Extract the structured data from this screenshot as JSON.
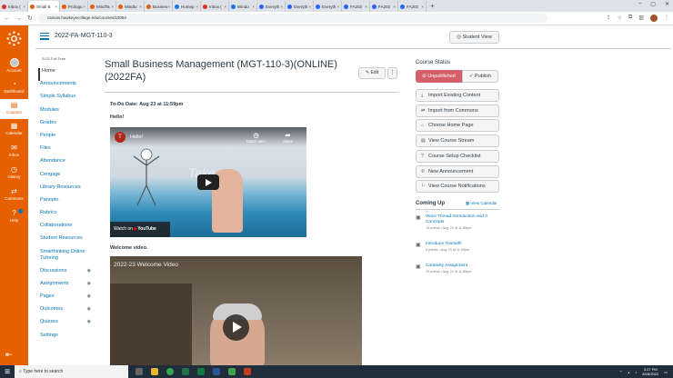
{
  "browser": {
    "tabs": [
      {
        "label": "Inbox (",
        "color": "#d93025"
      },
      {
        "label": "Small B",
        "color": "#e66000",
        "active": true
      },
      {
        "label": "Prologu",
        "color": "#e66000"
      },
      {
        "label": "MindTa",
        "color": "#e66000"
      },
      {
        "label": "Mindtu",
        "color": "#e66000"
      },
      {
        "label": "Busines",
        "color": "#e66000"
      },
      {
        "label": "Homep",
        "color": "#1a73e8"
      },
      {
        "label": "Inbox (",
        "color": "#d93025"
      },
      {
        "label": "Windo",
        "color": "#1a73e8"
      },
      {
        "label": "Everyth",
        "color": "#2962ff"
      },
      {
        "label": "Everyth",
        "color": "#2962ff"
      },
      {
        "label": "Everyth",
        "color": "#2962ff"
      },
      {
        "label": "FA202",
        "color": "#2962ff"
      },
      {
        "label": "FA202",
        "color": "#2962ff"
      },
      {
        "label": "FA202",
        "color": "#2962ff"
      }
    ],
    "url": "canvas.hawkeyecollege.edu/courses/10084"
  },
  "global_nav": {
    "account": "Account",
    "dashboard": "Dashboard",
    "courses": "Courses",
    "calendar": "Calendar",
    "inbox": "Inbox",
    "history": "History",
    "commons": "Commons",
    "help": "Help"
  },
  "header": {
    "breadcrumb": "2022-FA-MGT-110-3",
    "student_view": "Student View"
  },
  "course_nav": {
    "term": "2022 Fall Term",
    "items": [
      "Home",
      "Announcements",
      "Simple Syllabus",
      "Modules",
      "Grades",
      "People",
      "Files",
      "Attendance",
      "Cengage",
      "Library Resources",
      "Panopto",
      "Rubrics",
      "Collaborations",
      "Student Resources",
      "Smarthinking Online Tutoring",
      "Discussions",
      "Assignments",
      "Pages",
      "Outcomes",
      "Quizzes",
      "Settings"
    ]
  },
  "main": {
    "title": "Small Business Management (MGT-110-3)(ONLINE)(2022FA)",
    "edit": "Edit",
    "todo": "To-Do Date: Aug 23 at 11:59pm",
    "hello": "Hello!",
    "video1": {
      "channel_initial": "T",
      "title": "Hello!",
      "watch_later": "Watch later",
      "share": "Share",
      "watch_on": "Watch on",
      "youtube": "YouTube",
      "overlay": "Take Ha"
    },
    "welcome_label": "Welcome video.",
    "video2_title": "2022-23 Welcome Video"
  },
  "sidebar": {
    "status_heading": "Course Status",
    "unpublished": "Unpublished",
    "publish": "Publish",
    "buttons": [
      {
        "icon": "import-icon",
        "label": "Import Existing Content"
      },
      {
        "icon": "commons-icon",
        "label": "Import from Commons"
      },
      {
        "icon": "home-page-icon",
        "label": "Choose Home Page"
      },
      {
        "icon": "stream-icon",
        "label": "View Course Stream"
      },
      {
        "icon": "checklist-icon",
        "label": "Course Setup Checklist"
      },
      {
        "icon": "announcement-icon",
        "label": "New Announcement"
      },
      {
        "icon": "notifications-icon",
        "label": "View Course Notifications"
      }
    ],
    "coming_up": "Coming Up",
    "view_calendar": "View Calendar",
    "upcoming": [
      {
        "title": "Voice Thread Introduction and 3 Concepts",
        "meta": "15 points • Aug 23 at 11:59pm"
      },
      {
        "title": "Introduce Yourself!",
        "meta": "5 points • Aug 23 at 11:59pm"
      },
      {
        "title": "Creativity Assignment",
        "meta": "25 points • Aug 24 at 11:59pm"
      }
    ]
  },
  "taskbar": {
    "search_placeholder": "Type here to search",
    "time": "3:27 PM",
    "date": "8/18/2022"
  }
}
